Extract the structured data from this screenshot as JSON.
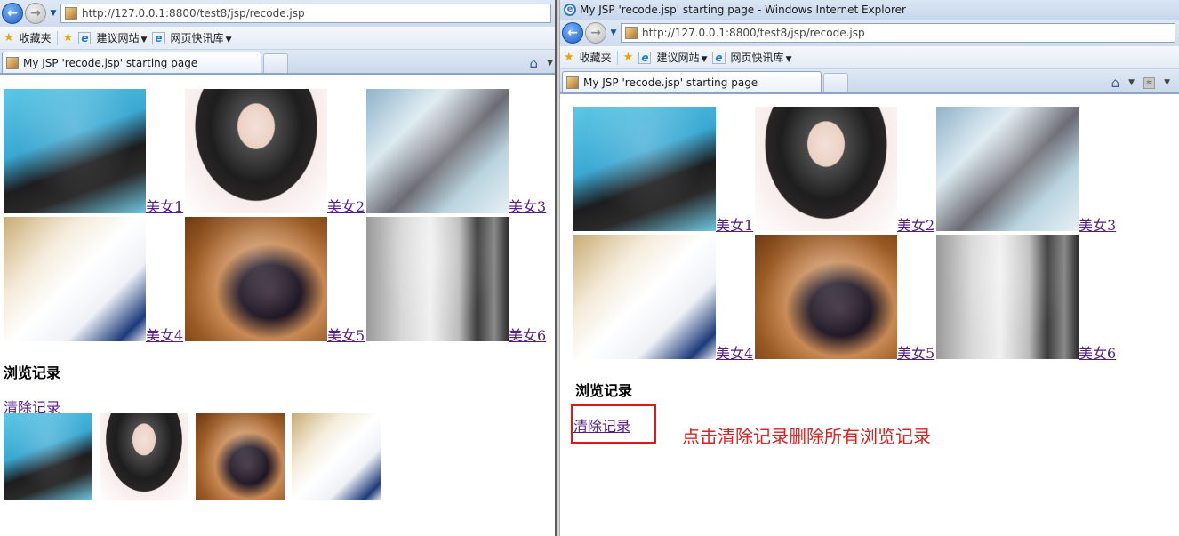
{
  "left_window": {
    "address": "http://127.0.0.1:8800/test8/jsp/recode.jsp",
    "favorites_label": "收藏夹",
    "suggested_sites": "建议网站",
    "web_slices": "网页快讯库",
    "tab_title": "My JSP 'recode.jsp' starting page",
    "gallery": [
      {
        "label": "美女1",
        "photo": "photo-1"
      },
      {
        "label": "美女2",
        "photo": "photo-2"
      },
      {
        "label": "美女3",
        "photo": "photo-3"
      },
      {
        "label": "美女4",
        "photo": "photo-4"
      },
      {
        "label": "美女5",
        "photo": "photo-5"
      },
      {
        "label": "美女6",
        "photo": "photo-6"
      }
    ],
    "history_title": "浏览记录",
    "clear_link": "清除记录",
    "history_items": [
      "photo-1",
      "photo-2",
      "photo-5",
      "photo-4"
    ]
  },
  "right_window": {
    "window_title": "My JSP 'recode.jsp' starting page - Windows Internet Explorer",
    "address": "http://127.0.0.1:8800/test8/jsp/recode.jsp",
    "favorites_label": "收藏夹",
    "suggested_sites": "建议网站",
    "web_slices": "网页快讯库",
    "tab_title": "My JSP 'recode.jsp' starting page",
    "gallery": [
      {
        "label": "美女1",
        "photo": "photo-1"
      },
      {
        "label": "美女2",
        "photo": "photo-2"
      },
      {
        "label": "美女3",
        "photo": "photo-3"
      },
      {
        "label": "美女4",
        "photo": "photo-4"
      },
      {
        "label": "美女5",
        "photo": "photo-5"
      },
      {
        "label": "美女6",
        "photo": "photo-6"
      }
    ],
    "history_title": "浏览记录",
    "clear_link": "清除记录",
    "annotation": "点击清除记录删除所有浏览记录"
  },
  "icons": {
    "back": "back-arrow-icon",
    "forward": "forward-arrow-icon",
    "favorites": "star-icon",
    "add_favorite": "add-favorite-star-icon",
    "page": "page-icon",
    "home": "home-icon",
    "feeds": "rss-icon"
  },
  "colors": {
    "link_visited": "#551a8b",
    "annotation_red": "#e02020",
    "chrome_blue": "#cfdcee"
  }
}
